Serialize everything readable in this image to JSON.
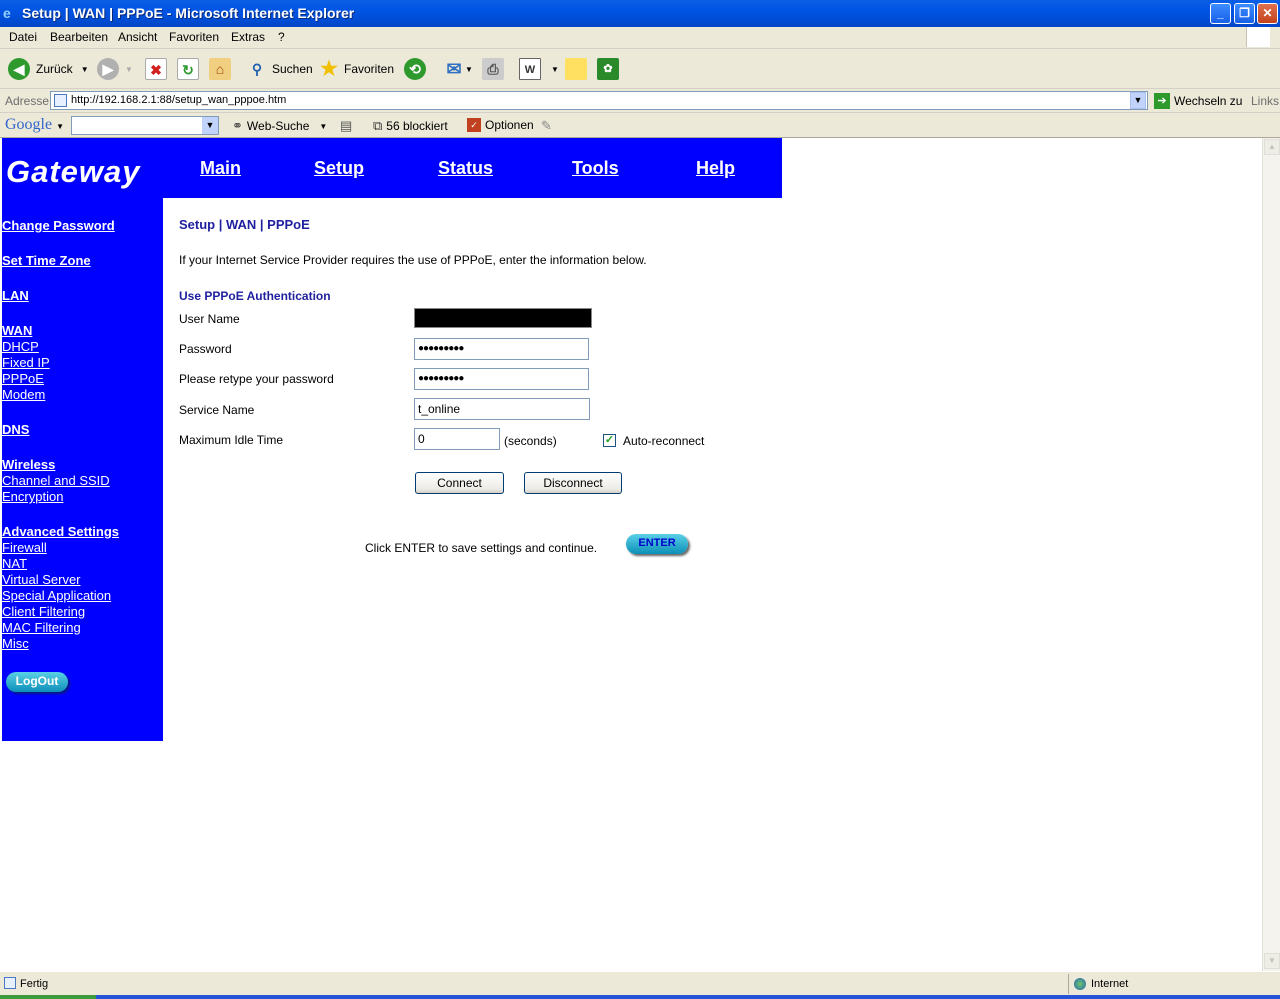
{
  "window": {
    "title": "Setup | WAN | PPPoE - Microsoft Internet Explorer"
  },
  "menu": {
    "items": [
      "Datei",
      "Bearbeiten",
      "Ansicht",
      "Favoriten",
      "Extras",
      "?"
    ]
  },
  "toolbar": {
    "back_label": "Zurück",
    "search_label": "Suchen",
    "favorites_label": "Favoriten"
  },
  "address": {
    "label": "Adresse",
    "url": "http://192.168.2.1:88/setup_wan_pppoe.htm",
    "go_label": "Wechseln zu",
    "links_label": "Links"
  },
  "google": {
    "logo": "Google",
    "websearch_label": "Web-Suche",
    "blocked_label": "56 blockiert",
    "options_label": "Optionen"
  },
  "header": {
    "logo": "Gateway",
    "nav": [
      "Main",
      "Setup",
      "Status",
      "Tools",
      "Help"
    ]
  },
  "sidebar": {
    "change_password": "Change  Password",
    "set_time_zone": "Set Time Zone",
    "lan": "LAN",
    "wan": "WAN",
    "wan_items": [
      "DHCP",
      "Fixed IP",
      "PPPoE",
      "Modem"
    ],
    "dns": "DNS",
    "wireless": "Wireless",
    "wireless_items": [
      "Channel and SSID",
      "Encryption"
    ],
    "advanced": "Advanced Settings",
    "advanced_items": [
      "Firewall",
      "NAT",
      "Virtual Server",
      "Special Application",
      "Client Filtering",
      "MAC Filtering",
      "Misc"
    ],
    "logout_label": "LogOut"
  },
  "main": {
    "breadcrumb": "Setup | WAN | PPPoE",
    "intro": "If your Internet Service Provider requires the use of PPPoE, enter the information below.",
    "section_title": "Use PPPoE Authentication",
    "username_label": "User Name",
    "password_label": "Password",
    "password_value": "●●●●●●●●●",
    "retype_label": "Please retype your password",
    "retype_value": "●●●●●●●●●",
    "service_label": "Service Name",
    "service_value": "t_online",
    "idle_label": "Maximum Idle Time",
    "idle_value": "0",
    "idle_unit": "(seconds)",
    "auto_reconnect_label": "Auto-reconnect",
    "auto_reconnect_checked": true,
    "connect_label": "Connect",
    "disconnect_label": "Disconnect",
    "save_text": "Click ENTER to save settings and continue.",
    "enter_label": "ENTER"
  },
  "status": {
    "text": "Fertig",
    "zone": "Internet"
  }
}
